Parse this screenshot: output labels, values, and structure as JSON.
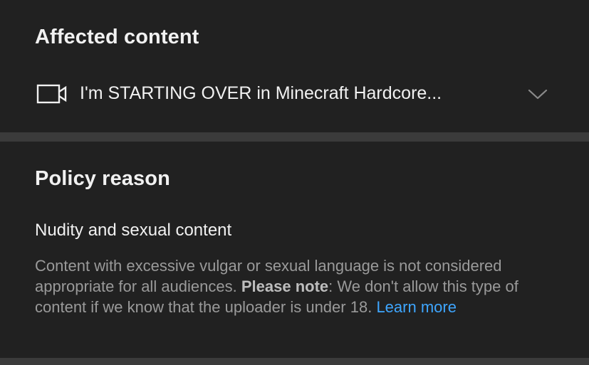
{
  "affected": {
    "title": "Affected content",
    "video_icon": "video-camera-icon",
    "video_title": "I'm STARTING OVER in Minecraft Hardcore...",
    "expand_icon": "chevron-down-icon"
  },
  "policy": {
    "title": "Policy reason",
    "reason_name": "Nudity and sexual content",
    "description_part1": "Content with excessive vulgar or sexual language is not considered appropriate for all audiences.",
    "note_label": "Please note",
    "description_part2": ": We don't allow this type of content if we know that the uploader is under 18.",
    "learn_more": "Learn more"
  },
  "colors": {
    "background": "#212121",
    "divider": "#3b3b3b",
    "primary_text": "#f1f1f1",
    "secondary_text": "#9a9a9a",
    "link": "#3ea6ff"
  }
}
